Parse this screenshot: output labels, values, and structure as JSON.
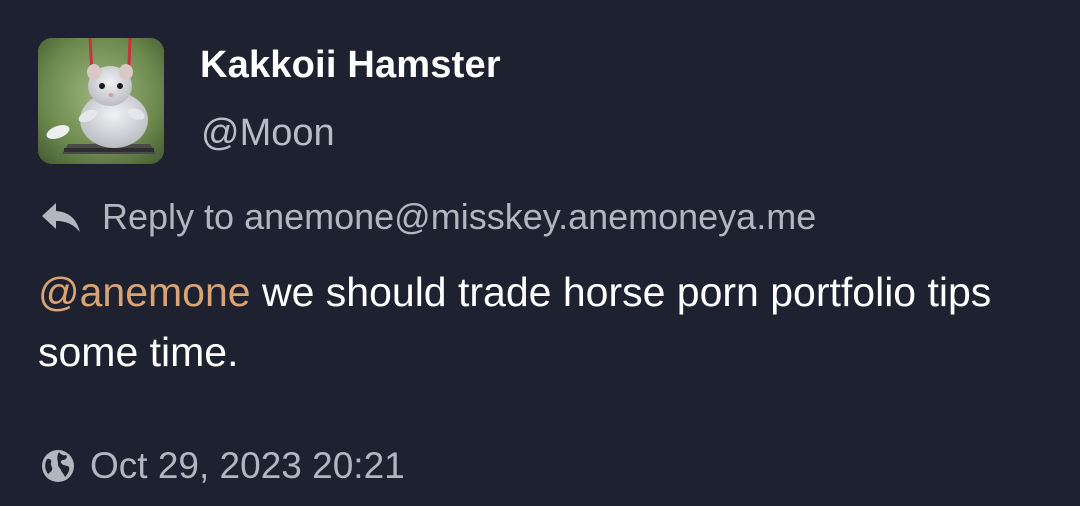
{
  "author": {
    "display_name": "Kakkoii Hamster",
    "handle": "@Moon"
  },
  "reply": {
    "icon": "reply-icon",
    "text": "Reply to anemone@misskey.anemoneya.me"
  },
  "post": {
    "mention": "@anemone",
    "text": " we should trade horse porn portfolio tips some time."
  },
  "footer": {
    "icon": "globe-icon",
    "timestamp": "Oct 29, 2023 20:21"
  },
  "colors": {
    "background": "#1d2130",
    "mention": "#d9a373",
    "muted_text": "#b3b6be"
  }
}
